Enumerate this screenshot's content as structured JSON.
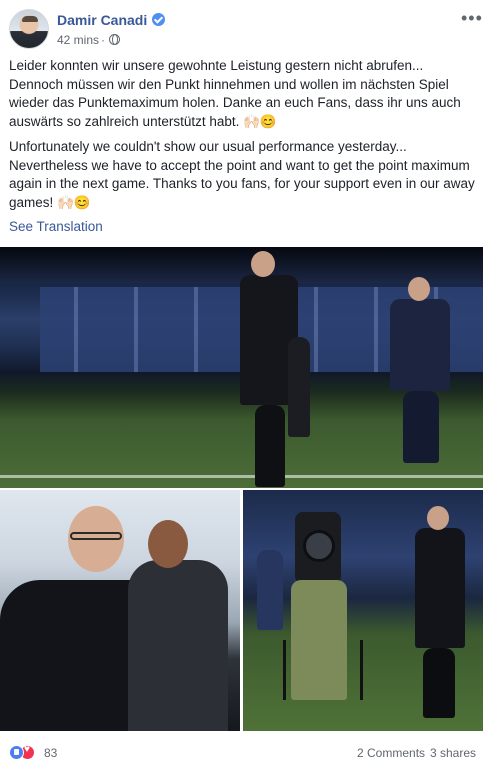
{
  "post": {
    "author": "Damir Canadi",
    "time": "42 mins",
    "text_de": "Leider konnten wir unsere gewohnte Leistung gestern nicht abrufen... Dennoch müssen wir den Punkt hinnehmen und wollen im nächsten Spiel wieder das Punktemaximum holen. Danke an euch Fans, dass ihr uns auch auswärts so zahlreich unterstützt habt. 🙌🏻😊",
    "text_en": "Unfortunately we couldn't show our usual performance yesterday... Nevertheless we have to accept the point and want to get the point maximum again in the next game. Thanks to you fans, for your support even in our away games! 🙌🏻😊",
    "see_translation": "See Translation"
  },
  "icons": {
    "verified": "verified-badge-icon",
    "privacy": "globe-icon",
    "more": "more-options-icon",
    "like": "like-reaction-icon",
    "love": "love-reaction-icon"
  },
  "colors": {
    "link": "#385898",
    "muted": "#616770",
    "verified": "#4d8ff2",
    "like": "#4b7ef2",
    "love": "#f0334f"
  },
  "footer": {
    "reactions": "83",
    "comments": "2 Comments",
    "shares": "3 shares"
  }
}
